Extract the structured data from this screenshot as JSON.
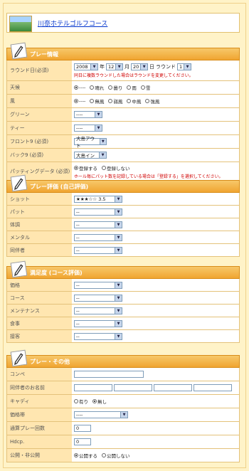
{
  "header": {
    "course_name": "川奈ホテルゴルフコース"
  },
  "play_info": {
    "title": "プレー情報",
    "round_date": {
      "label": "ラウンド日(必須)",
      "year": "2008",
      "year_unit": "年",
      "month": "12",
      "month_unit": "月",
      "day": "20",
      "day_unit": "日",
      "round_label": "ラウンド",
      "round": "1",
      "note": "同日に複数ラウンドした場合はラウンドを変更してください。"
    },
    "weather": {
      "label": "天候",
      "options": [
        "----",
        "晴れ",
        "曇り",
        "雨",
        "雪"
      ],
      "selected": 0
    },
    "wind": {
      "label": "風",
      "options": [
        "----",
        "無風",
        "弱風",
        "中風",
        "強風"
      ],
      "selected": 0
    },
    "green": {
      "label": "グリーン",
      "value": "----"
    },
    "tee": {
      "label": "ティー",
      "value": "----"
    },
    "front9": {
      "label": "フロント9 (必須)",
      "value": "大島アウト"
    },
    "back9": {
      "label": "バック9 (必須)",
      "value": "大島イン"
    },
    "putting": {
      "label": "パッティングデータ (必須)",
      "options": [
        "登録する",
        "登録しない"
      ],
      "selected": 0,
      "note": "ホール毎にパット数を記録している場合は「登録する」を選択してください。"
    }
  },
  "play_rating": {
    "title": "プレー評価 (自己評価)",
    "rows": [
      {
        "label": "ショット",
        "value": "★★★☆☆ 3.5"
      },
      {
        "label": "パット",
        "value": "--"
      },
      {
        "label": "体調",
        "value": "--"
      },
      {
        "label": "メンタル",
        "value": "--"
      },
      {
        "label": "同伴者",
        "value": "--"
      }
    ]
  },
  "satisfaction": {
    "title": "満足度 (コース評価)",
    "rows": [
      {
        "label": "価格",
        "value": "--"
      },
      {
        "label": "コース",
        "value": "--"
      },
      {
        "label": "メンテナンス",
        "value": "--"
      },
      {
        "label": "食事",
        "value": "--"
      },
      {
        "label": "接客",
        "value": "--"
      }
    ]
  },
  "other": {
    "title": "プレー・その他",
    "compe": {
      "label": "コンペ",
      "value": ""
    },
    "companions": {
      "label": "同伴者のお名前",
      "values": [
        "",
        "",
        "",
        ""
      ]
    },
    "caddie": {
      "label": "キャディ",
      "options": [
        "有り",
        "無し"
      ],
      "selected": 1
    },
    "price_band": {
      "label": "価格帯",
      "value": "----"
    },
    "total_rounds": {
      "label": "通算プレー回数",
      "value": "0"
    },
    "hdcp": {
      "label": "Hdcp.",
      "value": "0"
    },
    "visibility": {
      "label": "公開・非公開",
      "options": [
        "公開する",
        "公開しない"
      ],
      "selected": 0
    }
  }
}
